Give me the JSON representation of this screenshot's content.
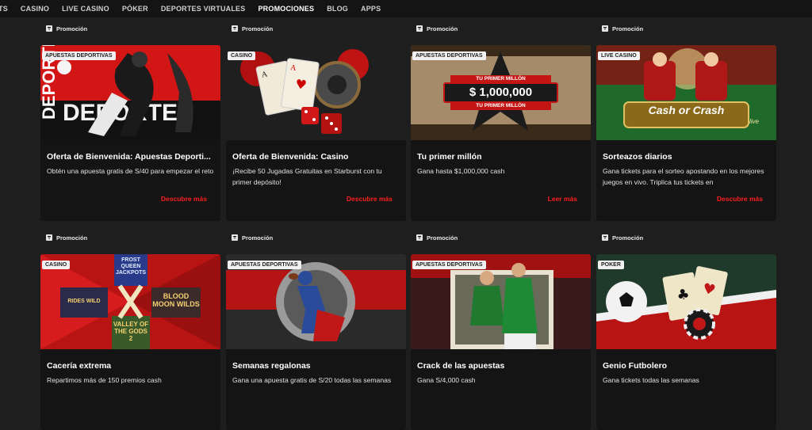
{
  "nav": {
    "items": [
      "TS",
      "CASINO",
      "LIVE CASINO",
      "PÓKER",
      "DEPORTES VIRTUALES",
      "PROMOCIONES",
      "BLOG",
      "APPS"
    ],
    "active": "PROMOCIONES"
  },
  "promo_label": "Promoción",
  "cards": [
    {
      "category": "APUESTAS DEPORTIVAS",
      "title": "Oferta de Bienvenida: Apuestas Deporti...",
      "desc": "Obtén una apuesta gratis de S/40 para empezar el reto",
      "cta": "Descubre más",
      "art_text": "DEPORTES DEPORTES"
    },
    {
      "category": "CASINO",
      "title": "Oferta de Bienvenida: Casino",
      "desc": "¡Recibe 50 Jugadas Gratuitas en Starburst con tu primer depósito!",
      "cta": "Descubre más",
      "art_text": ""
    },
    {
      "category": "APUESTAS DEPORTIVAS",
      "title": "Tu primer millón",
      "desc": "Gana hasta $1,000,000 cash",
      "cta": "Leer más",
      "art_text": "TU PRIMER MILLÓN|$ 1,000,000|TU PRIMER MILLÓN"
    },
    {
      "category": "LIVE CASINO",
      "title": "Sorteazos diarios",
      "desc": "Gana tickets para el sorteo apostando en los mejores juegos en vivo. Triplica tus tickets en",
      "cta": "Descubre más",
      "art_text": "Cash or Crash|live"
    },
    {
      "category": "CASINO",
      "title": "Cacería extrema",
      "desc": "Repartimos más de 150 premios cash",
      "cta": "",
      "art_text": "FROST QUEEN JACKPOTS|BLOOD MOON WILDS|VALLEY OF THE GODS 2|RIDES WILD"
    },
    {
      "category": "APUESTAS DEPORTIVAS",
      "title": "Semanas regalonas",
      "desc": "Gana una apuesta gratis de S/20 todas las semanas",
      "cta": "",
      "art_text": ""
    },
    {
      "category": "APUESTAS DEPORTIVAS",
      "title": "Crack de las apuestas",
      "desc": "Gana S/4,000 cash",
      "cta": "",
      "art_text": ""
    },
    {
      "category": "POKER",
      "title": "Genio Futbolero",
      "desc": "Gana tickets todas las semanas",
      "cta": "",
      "art_text": ""
    }
  ],
  "colors": {
    "accent": "#ff1f1f",
    "card_bg": "#141414",
    "page_bg": "#1e1e1e"
  }
}
